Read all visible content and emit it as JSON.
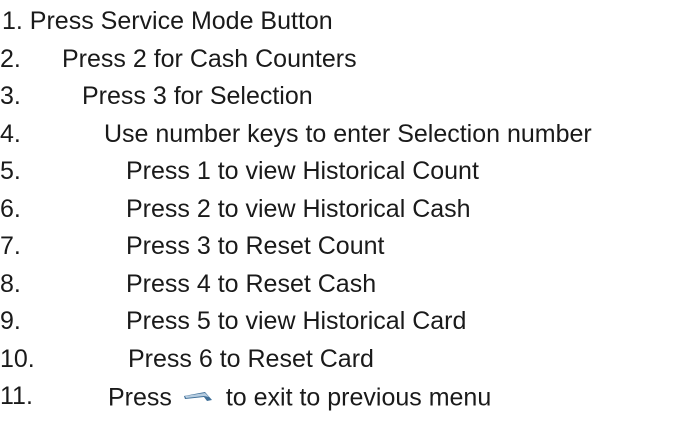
{
  "steps": [
    {
      "num": "",
      "text": "1. Press Service Mode Button"
    },
    {
      "num": "2.",
      "text": "Press 2 for Cash Counters"
    },
    {
      "num": "3.",
      "text": "Press 3 for Selection"
    },
    {
      "num": "4.",
      "text": "Use number keys to enter Selection number"
    },
    {
      "num": "5.",
      "text": "Press 1 to view Historical Count"
    },
    {
      "num": "6.",
      "text": "Press 2 to view Historical Cash"
    },
    {
      "num": "7.",
      "text": "Press 3 to Reset Count"
    },
    {
      "num": "8.",
      "text": "Press 4 to Reset Cash"
    },
    {
      "num": "9.",
      "text": "Press 5 to view Historical Card"
    },
    {
      "num": "10.",
      "text": "Press 6 to Reset Card"
    },
    {
      "num": "11.",
      "text_before": "Press",
      "icon": "exit-arrow-key-icon",
      "text_after": "to exit to previous menu"
    }
  ],
  "colors": {
    "text": "#1a1a1a",
    "icon_dark": "#3f6f98",
    "icon_light": "#b7cde0"
  }
}
